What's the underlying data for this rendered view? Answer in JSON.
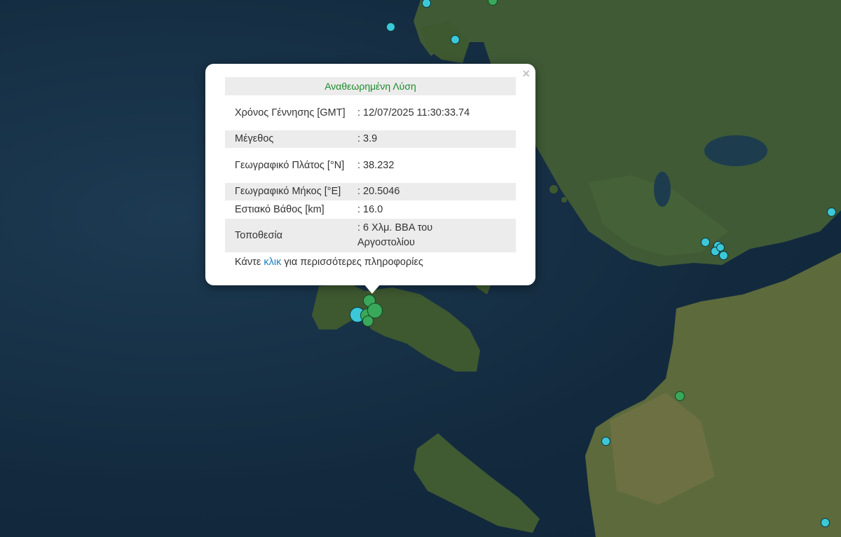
{
  "map": {
    "colors": {
      "sea": "#163046",
      "land": "#3f5a35",
      "marker_cyan": "#3cc8d8",
      "marker_green": "#3aa85a"
    }
  },
  "popup": {
    "header": "Αναθεωρημένη Λύση",
    "close_icon": "×",
    "rows": [
      {
        "label": "Χρόνος Γέννησης [GMT]",
        "value": ": 12/07/2025 11:30:33.74"
      },
      {
        "label": "Μέγεθος",
        "value": ": 3.9"
      },
      {
        "label": "Γεωγραφικό Πλάτος [°N]",
        "value": ": 38.232"
      },
      {
        "label": "Γεωγραφικό Μήκος [°E]",
        "value": ": 20.5046"
      },
      {
        "label": "Εστιακό Βάθος [km]",
        "value": ": 16.0"
      },
      {
        "label": "Τοποθεσία",
        "value": ": 6 Χλμ. ΒΒΑ του Αργοστολίου"
      }
    ],
    "footer_before": "Κάντε ",
    "footer_link": "κλικ",
    "footer_after": " για περισσότερες πληροφορίες"
  }
}
